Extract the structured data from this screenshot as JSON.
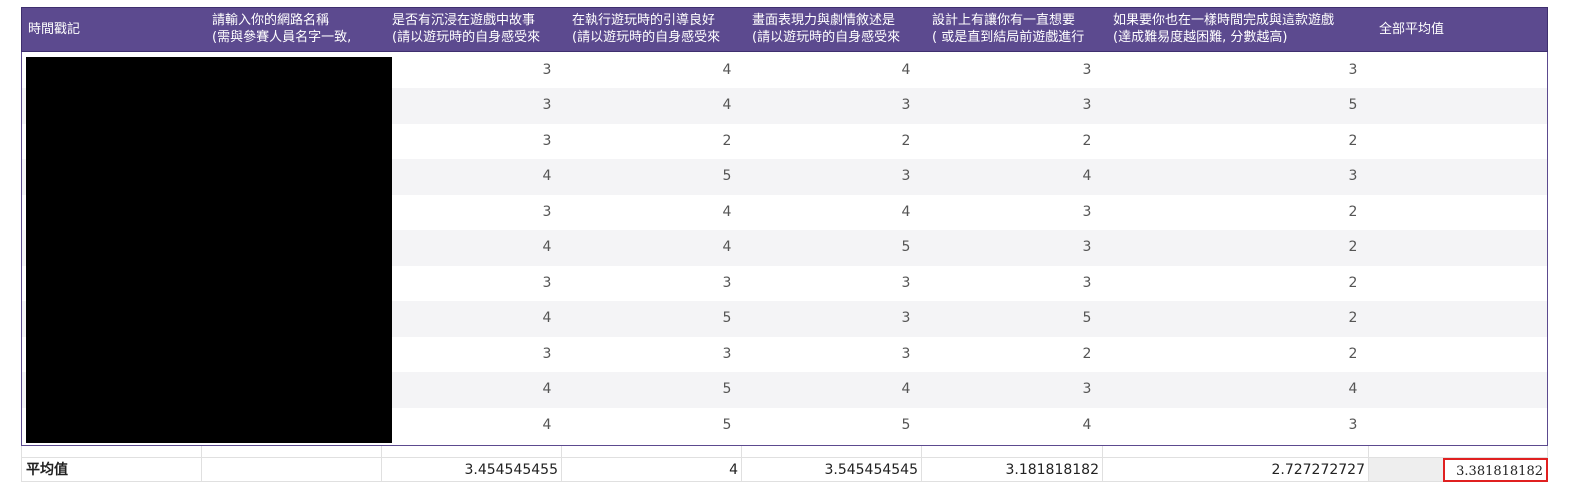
{
  "headers": [
    {
      "l1": "時間戳記",
      "l2": ""
    },
    {
      "l1": "請輸入你的網路名稱",
      "l2": "(需與參賽人員名字一致,"
    },
    {
      "l1": "是否有沉浸在遊戲中故事",
      "l2": "(請以遊玩時的自身感受來"
    },
    {
      "l1": "在執行遊玩時的引導良好",
      "l2": "(請以遊玩時的自身感受來"
    },
    {
      "l1": "畫面表現力與劇情敘述是",
      "l2": "(請以遊玩時的自身感受來"
    },
    {
      "l1": "設計上有讓你有一直想要",
      "l2": "( 或是直到結局前遊戲進行"
    },
    {
      "l1": "如果要你也在一樣時間完成與這款遊戲",
      "l2": "(達成難易度越困難, 分數越高)"
    },
    {
      "l1": "全部平均值",
      "l2": ""
    }
  ],
  "rows": [
    [
      3,
      4,
      4,
      3,
      3
    ],
    [
      3,
      4,
      3,
      3,
      5
    ],
    [
      3,
      2,
      2,
      2,
      2
    ],
    [
      4,
      5,
      3,
      4,
      3
    ],
    [
      3,
      4,
      4,
      3,
      2
    ],
    [
      4,
      4,
      5,
      3,
      2
    ],
    [
      3,
      3,
      3,
      3,
      2
    ],
    [
      4,
      5,
      3,
      5,
      2
    ],
    [
      3,
      3,
      3,
      2,
      2
    ],
    [
      4,
      5,
      4,
      3,
      4
    ],
    [
      4,
      5,
      5,
      4,
      3
    ]
  ],
  "footer": {
    "label": "平均值",
    "values": [
      "3.454545455",
      "4",
      "3.545454545",
      "3.181818182",
      "2.727272727"
    ],
    "overall": "3.381818182"
  },
  "colors": {
    "header_bg": "#5c4a8f",
    "selection": "#e02020"
  }
}
